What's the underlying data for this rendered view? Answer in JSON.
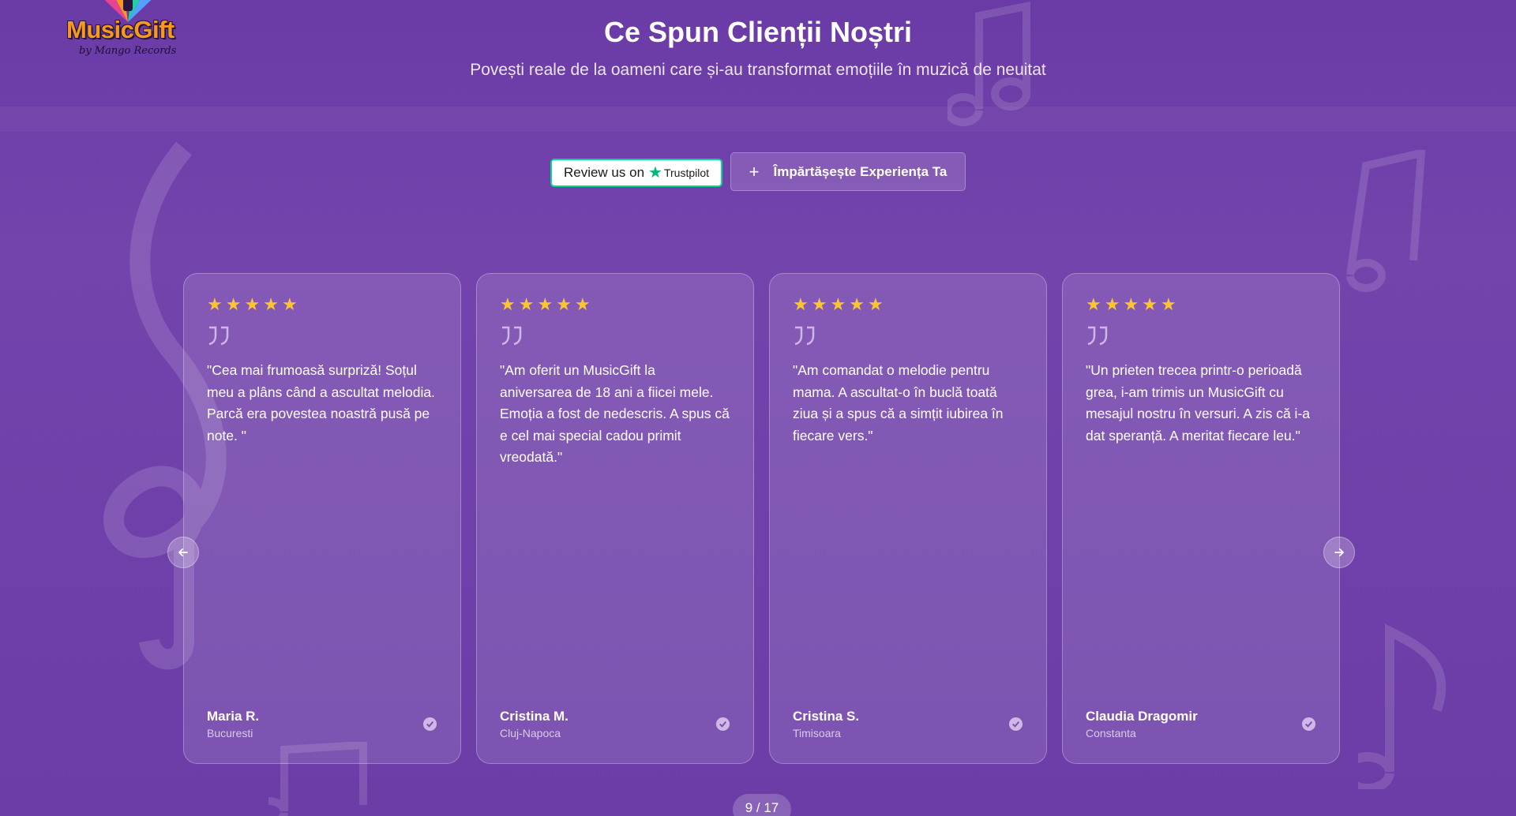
{
  "logo": {
    "brand": "MusicGift",
    "byline": "by Mango Records"
  },
  "header": {
    "title": "Ce Spun Clienții Noștri",
    "subtitle": "Povești reale de la oameni care și-au transformat emoțiile în muzică de neuitat"
  },
  "actions": {
    "trustpilot_prefix": "Review us on",
    "trustpilot_brand": "Trustpilot",
    "share_label": "Împărtășește Experiența Ta"
  },
  "reviews": [
    {
      "rating": 5,
      "text": "\"Cea mai frumoasă surpriză! Soțul meu a plâns când a ascultat melodia. Parcă era povestea noastră pusă pe note. \"",
      "author": "Maria R.",
      "city": "Bucuresti"
    },
    {
      "rating": 5,
      "text": "\"Am oferit un MusicGift la aniversarea de 18 ani a fiicei mele. Emoția a fost de nedescris. A spus că e cel mai special cadou primit vreodată.\"",
      "author": "Cristina M.",
      "city": "Cluj-Napoca"
    },
    {
      "rating": 5,
      "text": "\"Am comandat o melodie pentru mama. A ascultat-o în buclă toată ziua și a spus că a simțit iubirea în fiecare vers.\"",
      "author": "Cristina S.",
      "city": "Timisoara"
    },
    {
      "rating": 5,
      "text": "\"Un prieten trecea printr-o perioadă grea, i-am trimis un MusicGift cu mesajul nostru în versuri. A zis că i-a dat speranță. A meritat fiecare leu.\"",
      "author": "Claudia Dragomir",
      "city": "Constanta"
    }
  ],
  "pager": {
    "text": "9 / 17"
  },
  "colors": {
    "star": "#fbc531",
    "trustpilot_green": "#00b67a",
    "accent": "#6a3aa6"
  }
}
